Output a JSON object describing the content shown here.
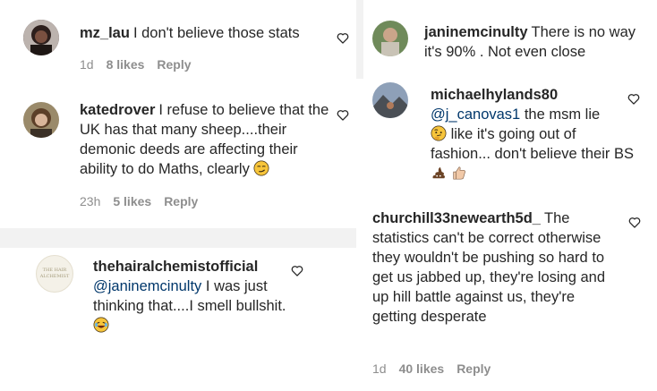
{
  "comments": [
    {
      "username": "mz_lau",
      "text": "I don't believe those stats",
      "time": "1d",
      "likes": "8 likes",
      "reply": "Reply"
    },
    {
      "username": "katedrover",
      "text": "I refuse to believe that the UK has that many sheep....their demonic deeds are affecting their ability to do Maths, clearly",
      "time": "23h",
      "likes": "5 likes",
      "reply": "Reply"
    },
    {
      "username": "thehairalchemistofficial",
      "mention": "@janinemcinulty",
      "text": "I was just thinking that....I smell bullshit.",
      "avatar_text": "THE HAIR ALCHEMIST"
    },
    {
      "username": "janinemcinulty",
      "text": "There is no way it's 90% . Not even close"
    },
    {
      "username": "michaelhylands80",
      "mention": "@j_canovas1",
      "text_a": "the msm lie",
      "text_b": "like it's going out of fashion... don't believe their BS"
    },
    {
      "username": "churchill33newearth5d_",
      "text": "The statistics can't be correct otherwise they wouldn't be pushing so hard to get us jabbed up, they're losing and up hill battle against us, they're getting desperate",
      "time": "1d",
      "likes": "40 likes",
      "reply": "Reply"
    }
  ],
  "icons": [
    "heart-outline-icon",
    "smirk-emoji-icon",
    "laughing-emoji-icon",
    "thinking-emoji-icon",
    "poop-emoji-icon",
    "thumbs-up-icon"
  ],
  "colors": {
    "mention": "#00376b",
    "meta": "#8e8e8e",
    "text": "#262626",
    "gap": "#f2f2f2"
  }
}
